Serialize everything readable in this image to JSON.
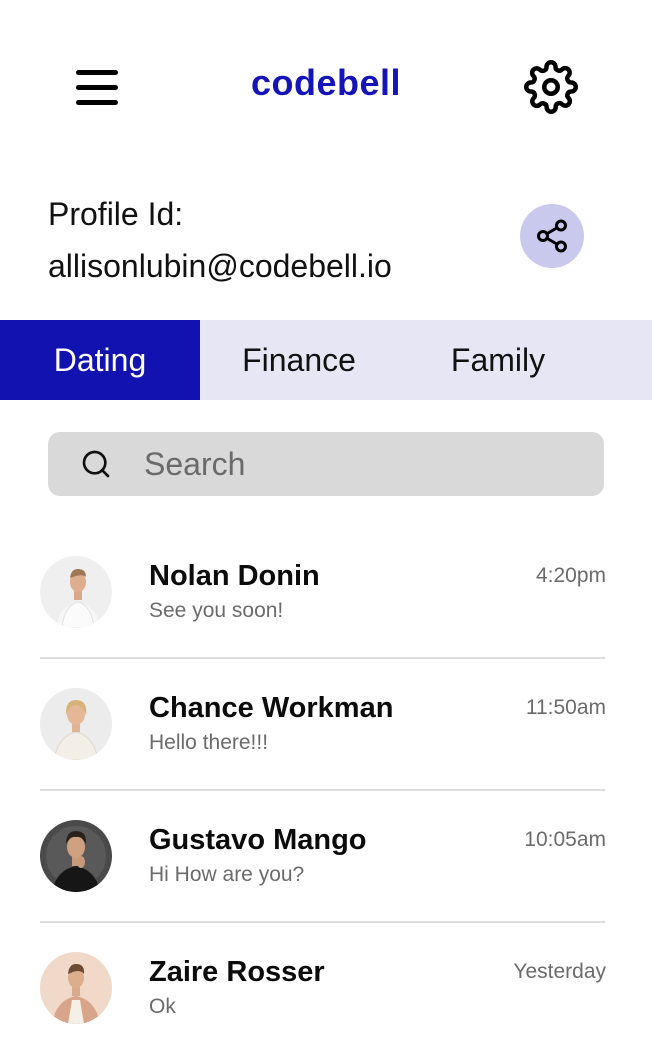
{
  "app": {
    "brand": "codebell",
    "brand_color": "#1414b8"
  },
  "header": {
    "menu_icon": "hamburger-menu-icon",
    "settings_icon": "gear-icon"
  },
  "profile": {
    "label": "Profile Id:",
    "id": "allisonlubin@codebell.io",
    "share_icon": "share-icon"
  },
  "tabs": [
    {
      "label": "Dating",
      "active": true
    },
    {
      "label": "Finance",
      "active": false
    },
    {
      "label": "Family",
      "active": false
    }
  ],
  "search": {
    "placeholder": "Search",
    "value": ""
  },
  "chats": [
    {
      "name": "Nolan Donin",
      "message": "See you soon!",
      "time": "4:20pm"
    },
    {
      "name": "Chance Workman",
      "message": "Hello there!!!",
      "time": "11:50am"
    },
    {
      "name": "Gustavo Mango",
      "message": "Hi How are you?",
      "time": "10:05am"
    },
    {
      "name": "Zaire Rosser",
      "message": "Ok",
      "time": "Yesterday"
    }
  ],
  "colors": {
    "tab_active_bg": "#1212b0",
    "tab_bar_bg": "#e6e6f5",
    "share_bg": "#c9c9ee",
    "search_bg": "#d9d9d9"
  }
}
